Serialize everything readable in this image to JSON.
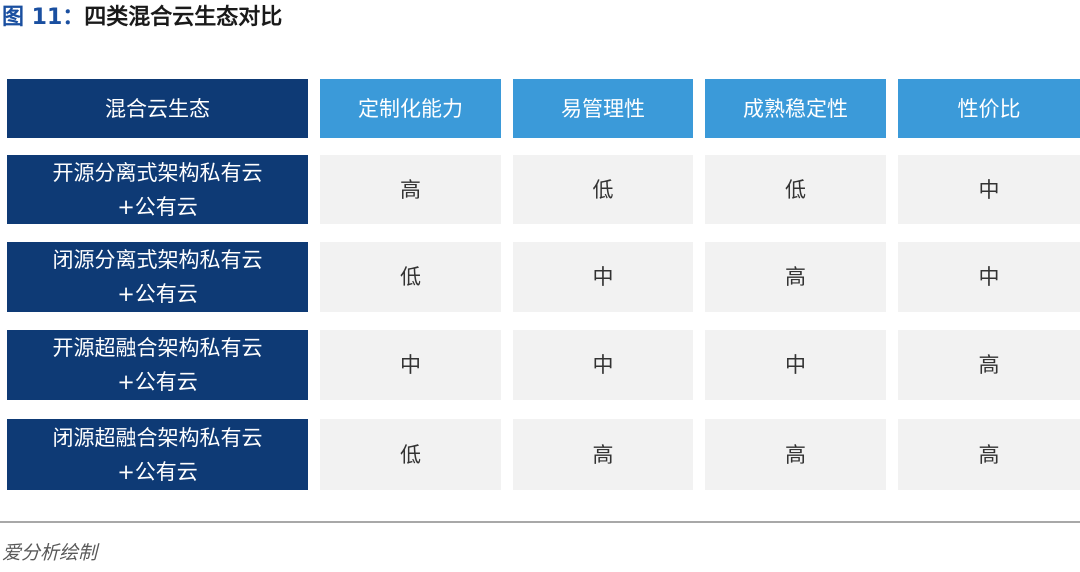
{
  "figure": {
    "label": "图 11：",
    "title": "四类混合云生态对比"
  },
  "table": {
    "corner_header": "混合云生态",
    "columns": [
      "定制化能力",
      "易管理性",
      "成熟稳定性",
      "性价比"
    ],
    "rows": [
      {
        "name_line1": "开源分离式架构私有云",
        "name_line2": "+公有云",
        "values": [
          "高",
          "低",
          "低",
          "中"
        ]
      },
      {
        "name_line1": "闭源分离式架构私有云",
        "name_line2": "+公有云",
        "values": [
          "低",
          "中",
          "高",
          "中"
        ]
      },
      {
        "name_line1": "开源超融合架构私有云",
        "name_line2": "+公有云",
        "values": [
          "中",
          "中",
          "中",
          "高"
        ]
      },
      {
        "name_line1": "闭源超融合架构私有云",
        "name_line2": "+公有云",
        "values": [
          "低",
          "高",
          "高",
          "高"
        ]
      }
    ]
  },
  "source": "爱分析绘制",
  "colors": {
    "header_dark": "#0e3a75",
    "header_light": "#3b9ad9",
    "cell_bg": "#f2f2f2",
    "title_label": "#1a4fa0"
  }
}
